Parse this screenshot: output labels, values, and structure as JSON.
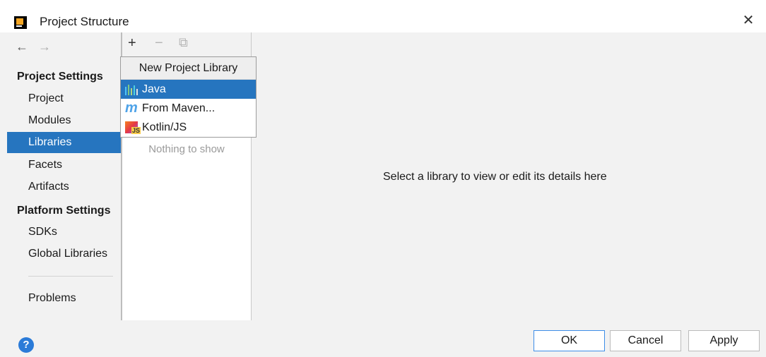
{
  "window": {
    "title": "Project Structure",
    "close_glyph": "✕"
  },
  "nav": {
    "back": "←",
    "forward": "→"
  },
  "sidebar": {
    "project_settings_title": "Project Settings",
    "project_items": [
      "Project",
      "Modules",
      "Libraries",
      "Facets",
      "Artifacts"
    ],
    "platform_settings_title": "Platform Settings",
    "platform_items": [
      "SDKs",
      "Global Libraries"
    ],
    "problems": "Problems",
    "selected": "Libraries"
  },
  "toolbar": {
    "add": "+",
    "remove": "−",
    "copy": "⧉"
  },
  "library_list": {
    "empty_text": "Nothing to show"
  },
  "popup": {
    "header": "New Project Library",
    "items": [
      {
        "label": "Java",
        "icon": "java-library-icon",
        "selected": true
      },
      {
        "label": "From Maven...",
        "icon": "maven-icon",
        "selected": false
      },
      {
        "label": "Kotlin/JS",
        "icon": "kotlin-js-icon",
        "selected": false
      }
    ]
  },
  "detail": {
    "message": "Select a library to view or edit its details here"
  },
  "buttons": {
    "help": "?",
    "ok": "OK",
    "cancel": "Cancel",
    "apply": "Apply"
  },
  "colors": {
    "selection": "#2675bf",
    "default_button_border": "#3d8ee8",
    "help": "#2b7bd8"
  }
}
